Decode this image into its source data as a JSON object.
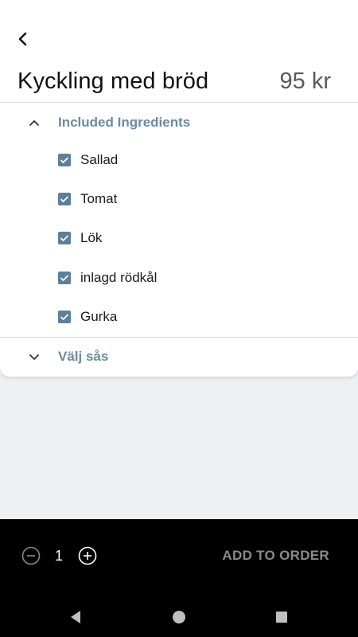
{
  "header": {
    "back_icon": "chevron-left-icon",
    "title": "Kyckling med bröd",
    "price": "95 kr"
  },
  "sections": {
    "included": {
      "label": "Included Ingredients",
      "expanded": true,
      "items": [
        {
          "label": "Sallad",
          "checked": true
        },
        {
          "label": "Tomat",
          "checked": true
        },
        {
          "label": "Lök",
          "checked": true
        },
        {
          "label": "inlagd rödkål",
          "checked": true
        },
        {
          "label": "Gurka",
          "checked": true
        }
      ]
    },
    "sauce": {
      "label": "Välj sås",
      "expanded": false
    }
  },
  "order": {
    "quantity": "1",
    "add_label": "ADD TO ORDER"
  },
  "colors": {
    "accent": "#6a8aa3",
    "checkbox": "#5c7f9c",
    "background": "#eef1f2"
  }
}
